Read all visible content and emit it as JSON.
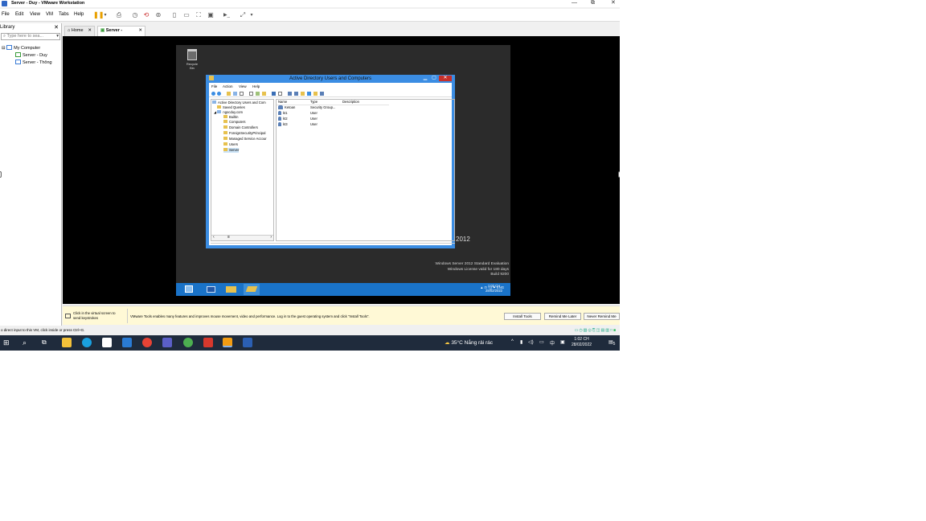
{
  "window": {
    "title": "Server - Duy - VMware Workstation",
    "controls": {
      "minimize": "—",
      "restore": "⧉",
      "close": "✕"
    }
  },
  "menubar": {
    "items": [
      "File",
      "Edit",
      "View",
      "VM",
      "Tabs",
      "Help"
    ],
    "toolbar_icons": [
      "pause-icon",
      "send-ctrl-alt-del-icon",
      "snapshot-icon",
      "revert-snapshot-icon",
      "snapshot-manager-icon",
      "library-view-icon",
      "thumbnail-bar-icon",
      "fullscreen-icon",
      "unity-icon",
      "console-icon",
      "stretch-icon"
    ]
  },
  "library": {
    "title": "Library",
    "close": "✕",
    "search_placeholder": "Type here to sea...",
    "tree": {
      "root": "My Computer",
      "vms": [
        "Server - Duy",
        "Server - Thông"
      ]
    }
  },
  "tabs": [
    {
      "label": "Home",
      "close": "✕"
    },
    {
      "label": "Server -",
      "close": "✕"
    }
  ],
  "guest": {
    "recycle_bin": "Recycle Bin",
    "aduc": {
      "title": "Active Directory Users and Computers",
      "menu": [
        "File",
        "Action",
        "View",
        "Help"
      ],
      "tree": [
        "Active Directory Users and Com",
        "Saved Queries",
        "ngocduy.com",
        "Builtin",
        "Computers",
        "Domain Controllers",
        "ForeignSecurityPrincipal",
        "Managed Service Accour",
        "Users",
        "Server"
      ],
      "columns": [
        "Name",
        "Type",
        "Description"
      ],
      "rows": [
        {
          "name": "Ketoan",
          "type": "Security Group..."
        },
        {
          "name": "kt1",
          "type": "User"
        },
        {
          "name": "kt2",
          "type": "User"
        },
        {
          "name": "kt3",
          "type": "User"
        }
      ]
    },
    "brand": "2012",
    "watermark": [
      "Windows Server 2012 Standard Evaluation",
      "Windows License valid for 180 days",
      "Build 9200"
    ],
    "taskbar": {
      "lang": "ENG",
      "time": "1:02 CH",
      "date": "28/02/2022"
    }
  },
  "notice": {
    "hint_line1": "Click in the virtual screen to",
    "hint_line2": "send keystrokes",
    "message": "VMware Tools enables many features and improves mouse movement, video and performance. Log in to the guest operating system and click \"Install Tools\".",
    "buttons": [
      "Install Tools",
      "Remind Me Later",
      "Never Remind Me"
    ]
  },
  "status": {
    "text": "o direct input to this VM, click inside or press Ctrl+G."
  },
  "host_taskbar": {
    "weather": "35°C  Nắng rải rác",
    "ime": "中",
    "time": "1:02 CH",
    "date": "28/02/2022",
    "notifications": "5"
  }
}
